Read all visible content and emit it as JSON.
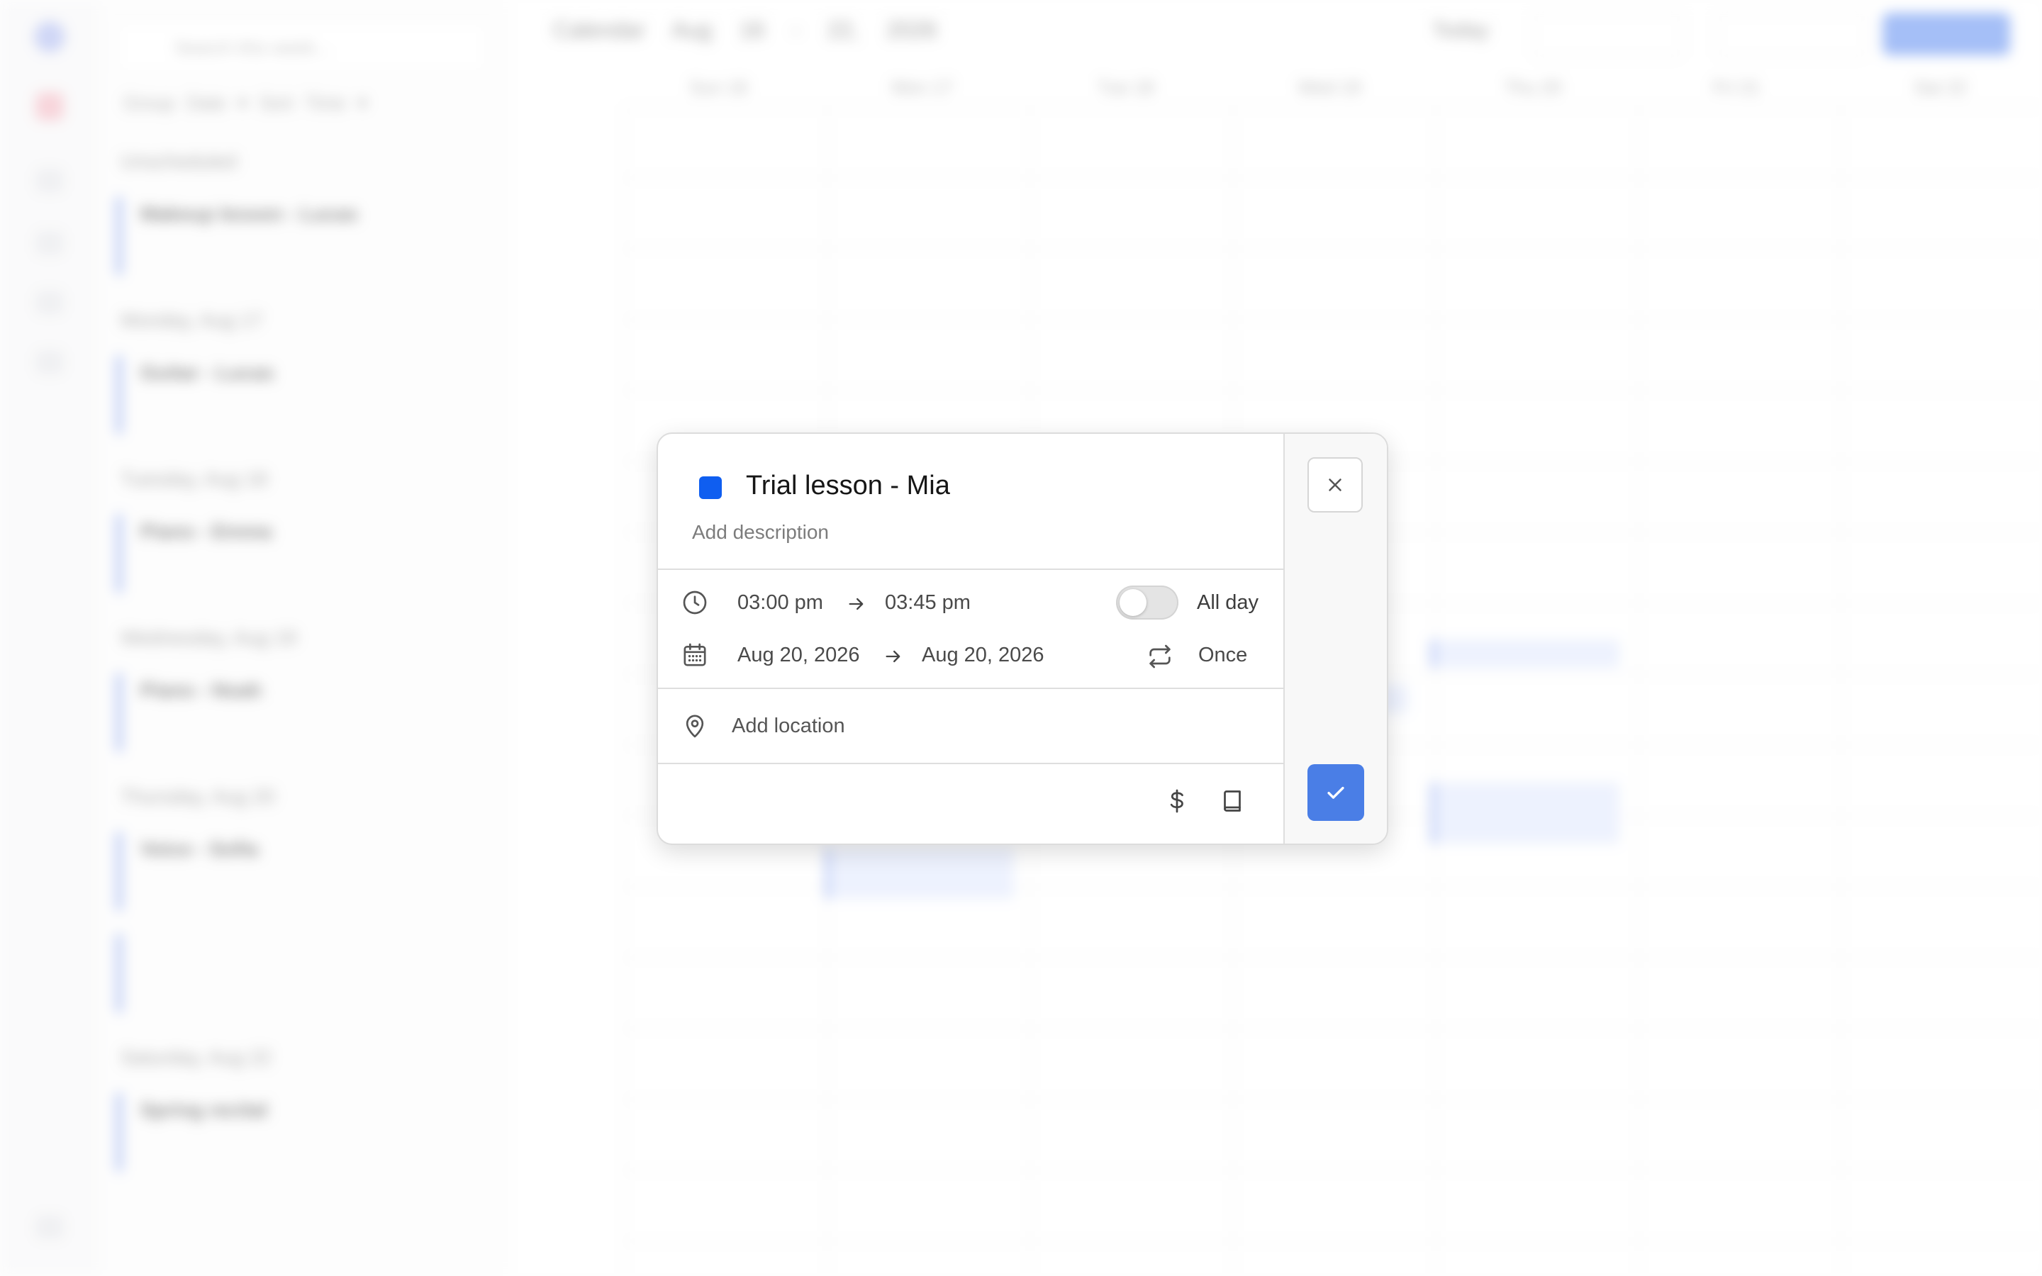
{
  "background": {
    "search_placeholder": "Search this week...",
    "filters": "Group Date ▾   Sort Time ▾",
    "calendar_label": "Calendar",
    "date_range": "Aug 16 - 22, 2026",
    "today_label": "Today",
    "days": [
      "Sun 16",
      "Mon 17",
      "Tue 18",
      "Wed 19",
      "Thu 20",
      "Fri 21",
      "Sat 22"
    ],
    "agenda": [
      {
        "section": "Unscheduled",
        "title": "Makeup lesson - Lucas"
      },
      {
        "section": "Monday, Aug 17",
        "title": "Guitar - Lucas"
      },
      {
        "section": "Tuesday, Aug 18",
        "title": "Piano - Emma"
      },
      {
        "section": "Wednesday, Aug 19",
        "title": "Piano - Noah"
      },
      {
        "section": "Thursday, Aug 20",
        "title": "Voice - Sofia"
      },
      {
        "section": "Saturday, Aug 22",
        "title": "Spring recital"
      }
    ]
  },
  "dialog": {
    "color": "#0f5ef0",
    "title": "Trial lesson - Mia",
    "description_placeholder": "Add description",
    "start_time": "03:00 pm",
    "end_time": "03:45 pm",
    "all_day_label": "All day",
    "all_day": false,
    "start_date": "Aug 20, 2026",
    "end_date": "Aug 20, 2026",
    "repeat_label": "Once",
    "location_placeholder": "Add location"
  }
}
